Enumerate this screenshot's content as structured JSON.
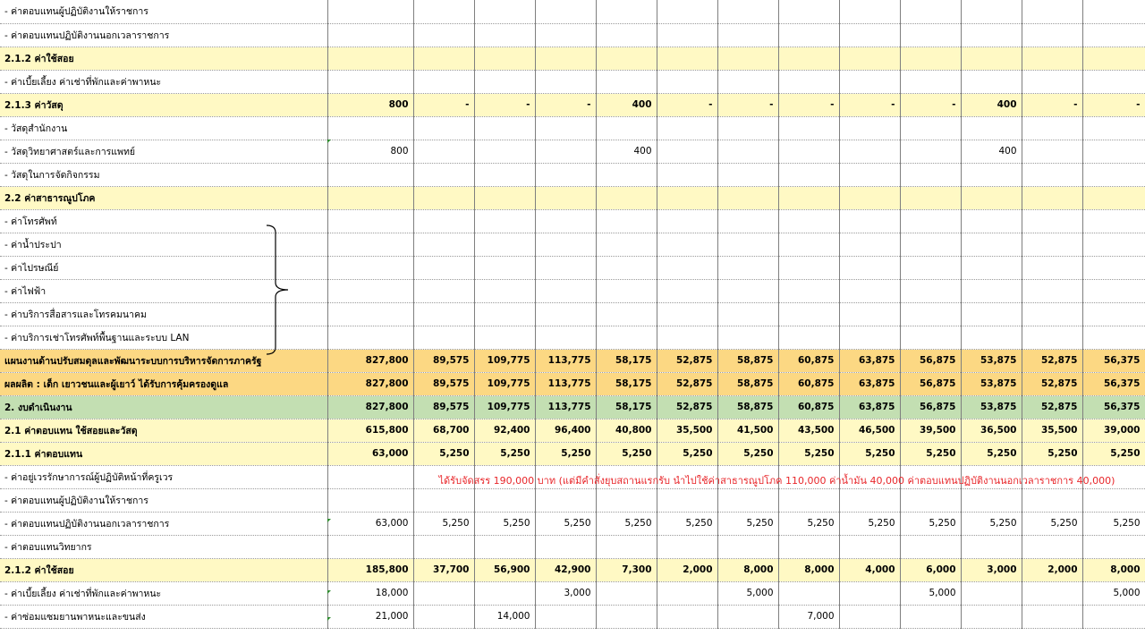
{
  "spreadsheet": {
    "note": "ได้รับจัดสรร 190,000 บาท (แต่มีคำสั่งยุบสถานแรกรับ นำไปใช้ค่าสาธารณูปโภค 110,000 ค่าน้ำมัน 40,000 ค่าตอบแทนปฏิบัติงานนอกเวลาราชการ 40,000)",
    "rows": [
      {
        "label": "- ค่าตอบแทนผู้ปฏิบัติงานให้ราชการ",
        "style": "plain",
        "cells": [
          "",
          "",
          "",
          "",
          "",
          "",
          "",
          "",
          "",
          "",
          "",
          "",
          ""
        ]
      },
      {
        "label": "- ค่าตอบแทนปฏิบัติงานนอกเวลาราชการ",
        "style": "plain",
        "cells": [
          "",
          "",
          "",
          "",
          "",
          "",
          "",
          "",
          "",
          "",
          "",
          "",
          ""
        ]
      },
      {
        "label": "2.1.2 ค่าใช้สอย",
        "style": "yellow",
        "cells": [
          "",
          "",
          "",
          "",
          "",
          "",
          "",
          "",
          "",
          "",
          "",
          "",
          ""
        ]
      },
      {
        "label": "- ค่าเบี้ยเลี้ยง ค่าเช่าที่พักและค่าพาหนะ",
        "style": "plain",
        "cells": [
          "",
          "",
          "",
          "",
          "",
          "",
          "",
          "",
          "",
          "",
          "",
          "",
          ""
        ]
      },
      {
        "label": "2.1.3 ค่าวัสดุ",
        "style": "yellow",
        "cells": [
          "800",
          "-",
          "-",
          "-",
          "400",
          "-",
          "-",
          "-",
          "-",
          "-",
          "400",
          "-",
          "-"
        ]
      },
      {
        "label": "- วัสดุสำนักงาน",
        "style": "plain",
        "cells": [
          "",
          "",
          "",
          "",
          "",
          "",
          "",
          "",
          "",
          "",
          "",
          "",
          ""
        ]
      },
      {
        "label": "- วัสดุวิทยาศาสตร์และการแพทย์",
        "style": "plain",
        "cells": [
          "800",
          "",
          "",
          "",
          "400",
          "",
          "",
          "",
          "",
          "",
          "400",
          "",
          ""
        ]
      },
      {
        "label": "- วัสดุในการจัดกิจกรรม",
        "style": "plain",
        "cells": [
          "",
          "",
          "",
          "",
          "",
          "",
          "",
          "",
          "",
          "",
          "",
          "",
          ""
        ]
      },
      {
        "label": "2.2 ค่าสาธารณูปโภค",
        "style": "yellow",
        "cells": [
          "",
          "",
          "",
          "",
          "",
          "",
          "",
          "",
          "",
          "",
          "",
          "",
          ""
        ]
      },
      {
        "label": "- ค่าโทรศัพท์",
        "style": "indent",
        "cells": [
          "",
          "",
          "",
          "",
          "",
          "",
          "",
          "",
          "",
          "",
          "",
          "",
          ""
        ]
      },
      {
        "label": "- ค่าน้ำประปา",
        "style": "indent",
        "cells": [
          "",
          "",
          "",
          "",
          "",
          "",
          "",
          "",
          "",
          "",
          "",
          "",
          ""
        ]
      },
      {
        "label": "- ค่าไปรษณีย์",
        "style": "indent",
        "cells": [
          "",
          "",
          "",
          "",
          "",
          "",
          "",
          "",
          "",
          "",
          "",
          "",
          ""
        ]
      },
      {
        "label": "- ค่าไฟฟ้า",
        "style": "indent",
        "cells": [
          "",
          "",
          "",
          "",
          "",
          "",
          "",
          "",
          "",
          "",
          "",
          "",
          ""
        ]
      },
      {
        "label": "- ค่าบริการสื่อสารและโทรคมนาคม",
        "style": "indent",
        "cells": [
          "",
          "",
          "",
          "",
          "",
          "",
          "",
          "",
          "",
          "",
          "",
          "",
          ""
        ]
      },
      {
        "label": "- ค่าบริการเช่าโทรศัพท์พื้นฐานและระบบ LAN",
        "style": "indent",
        "cells": [
          "",
          "",
          "",
          "",
          "",
          "",
          "",
          "",
          "",
          "",
          "",
          "",
          ""
        ]
      },
      {
        "label": "แผนงานด้านปรับสมดุลและพัฒนาระบบการบริหารจัดการภาครัฐ",
        "style": "orange",
        "cells": [
          "827,800",
          "89,575",
          "109,775",
          "113,775",
          "58,175",
          "52,875",
          "58,875",
          "60,875",
          "63,875",
          "56,875",
          "53,875",
          "52,875",
          "56,375"
        ]
      },
      {
        "label": "ผลผลิต : เด็ก เยาวชนและผู้เยาว์ ได้รับการคุ้มครองดูแล",
        "style": "orange",
        "cells": [
          "827,800",
          "89,575",
          "109,775",
          "113,775",
          "58,175",
          "52,875",
          "58,875",
          "60,875",
          "63,875",
          "56,875",
          "53,875",
          "52,875",
          "56,375"
        ]
      },
      {
        "label": "2. งบดำเนินงาน",
        "style": "green",
        "cells": [
          "827,800",
          "89,575",
          "109,775",
          "113,775",
          "58,175",
          "52,875",
          "58,875",
          "60,875",
          "63,875",
          "56,875",
          "53,875",
          "52,875",
          "56,375"
        ]
      },
      {
        "label": "2.1 ค่าตอบแทน ใช้สอยและวัสดุ",
        "style": "yellow",
        "cells": [
          "615,800",
          "68,700",
          "92,400",
          "96,400",
          "40,800",
          "35,500",
          "41,500",
          "43,500",
          "46,500",
          "39,500",
          "36,500",
          "35,500",
          "39,000"
        ]
      },
      {
        "label": "2.1.1 ค่าตอบแทน",
        "style": "yellow",
        "cells": [
          "63,000",
          "5,250",
          "5,250",
          "5,250",
          "5,250",
          "5,250",
          "5,250",
          "5,250",
          "5,250",
          "5,250",
          "5,250",
          "5,250",
          "5,250"
        ]
      },
      {
        "label": "- ค่าอยู่เวรรักษาการณ์ผู้ปฏิบัติหน้าที่ครูเวร",
        "style": "note",
        "cells": [
          "",
          "",
          "",
          "",
          "",
          "",
          "",
          "",
          "",
          "",
          "",
          "",
          ""
        ]
      },
      {
        "label": "- ค่าตอบแทนผู้ปฏิบัติงานให้ราชการ",
        "style": "plain",
        "cells": [
          "",
          "",
          "",
          "",
          "",
          "",
          "",
          "",
          "",
          "",
          "",
          "",
          ""
        ]
      },
      {
        "label": "- ค่าตอบแทนปฏิบัติงานนอกเวลาราชการ",
        "style": "plain",
        "cells": [
          "63,000",
          "5,250",
          "5,250",
          "5,250",
          "5,250",
          "5,250",
          "5,250",
          "5,250",
          "5,250",
          "5,250",
          "5,250",
          "5,250",
          "5,250"
        ]
      },
      {
        "label": "- ค่าตอบแทนวิทยากร",
        "style": "plain",
        "cells": [
          "",
          "",
          "",
          "",
          "",
          "",
          "",
          "",
          "",
          "",
          "",
          "",
          ""
        ]
      },
      {
        "label": "2.1.2 ค่าใช้สอย",
        "style": "yellow",
        "cells": [
          "185,800",
          "37,700",
          "56,900",
          "42,900",
          "7,300",
          "2,000",
          "8,000",
          "8,000",
          "4,000",
          "6,000",
          "3,000",
          "2,000",
          "8,000"
        ]
      },
      {
        "label": "- ค่าเบี้ยเลี้ยง ค่าเช่าที่พักและค่าพาหนะ",
        "style": "plain",
        "cells": [
          "18,000",
          "",
          "",
          "3,000",
          "",
          "",
          "5,000",
          "",
          "",
          "5,000",
          "",
          "",
          "5,000"
        ]
      },
      {
        "label": "- ค่าซ่อมแซมยานพาหนะและขนส่ง",
        "style": "plain",
        "cells": [
          "21,000",
          "",
          "14,000",
          "",
          "",
          "",
          "",
          "7,000",
          "",
          "",
          "",
          "",
          ""
        ]
      }
    ]
  }
}
